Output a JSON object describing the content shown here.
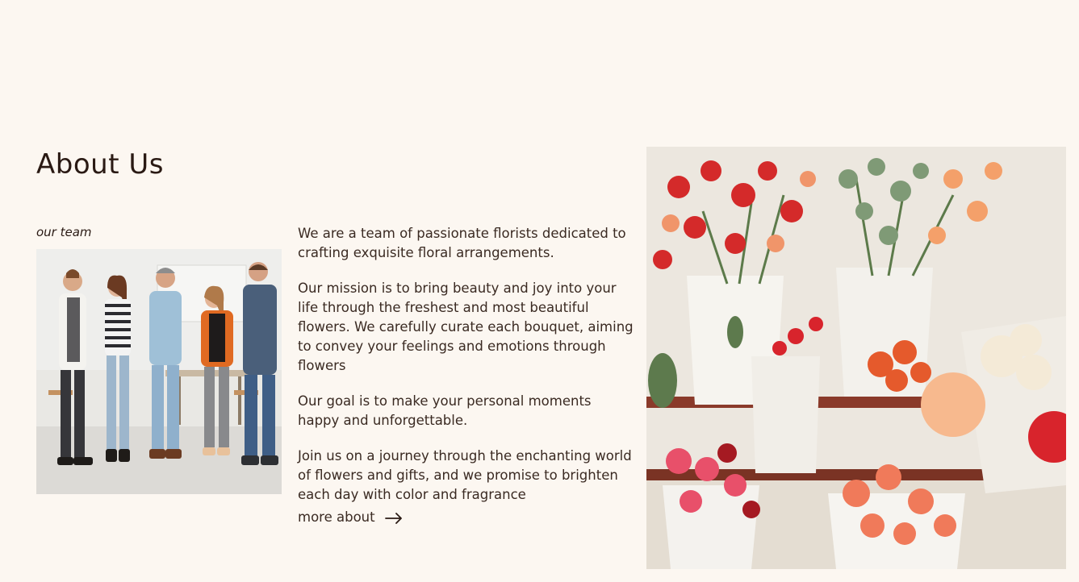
{
  "section": {
    "title": "About Us",
    "team_caption": "our team",
    "paragraphs": [
      "We are a team of passionate florists dedicated to crafting exquisite floral arrangements.",
      "Our mission is to bring beauty and joy into your life through the freshest and most beautiful flowers. We carefully curate each bouquet, aiming to convey your feelings and emotions through flowers",
      "Our goal is to make your personal moments happy and unforgettable.",
      "Join us on a journey through the enchanting world of flowers and gifts, and we promise to brighten each day with color and fragrance"
    ],
    "more_link_label": "more about"
  },
  "icons": {
    "more_link_icon": "arrow-right-icon"
  },
  "colors": {
    "background": "#fcf7f1",
    "text": "#2a1a14"
  }
}
